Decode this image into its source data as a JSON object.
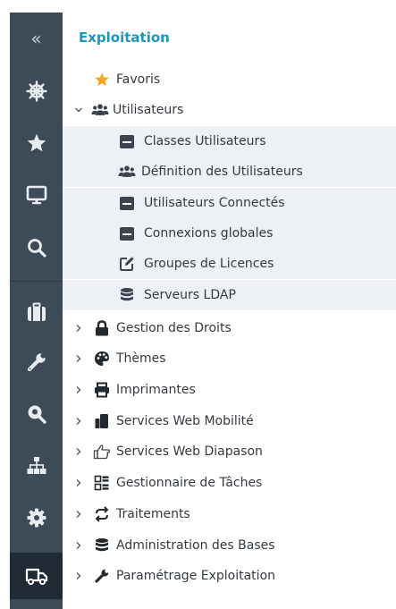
{
  "rail": {
    "collapse_glyph": "«",
    "items": [
      {
        "icon": "helm-icon"
      },
      {
        "icon": "star-icon"
      },
      {
        "icon": "monitor-icon"
      },
      {
        "icon": "search-icon"
      },
      {
        "icon": "suitcase-icon"
      },
      {
        "icon": "wrench-icon"
      },
      {
        "icon": "map-pin-search-icon"
      },
      {
        "icon": "sitemap-icon"
      },
      {
        "icon": "gear-icon"
      },
      {
        "icon": "truck-icon",
        "active": true
      }
    ]
  },
  "panel": {
    "title": "Exploitation",
    "favoris": "Favoris",
    "utilisateurs": {
      "label": "Utilisateurs",
      "children": [
        {
          "label": "Classes Utilisateurs",
          "icon": "window-icon"
        },
        {
          "label": "Définition des Utilisateurs",
          "icon": "users-icon"
        },
        {
          "label": "Utilisateurs Connectés",
          "icon": "window-icon"
        },
        {
          "label": "Connexions globales",
          "icon": "window-icon"
        },
        {
          "label": "Groupes de Licences",
          "icon": "edit-icon"
        },
        {
          "label": "Serveurs LDAP",
          "icon": "database-icon"
        }
      ]
    },
    "groups": [
      {
        "label": "Gestion des Droits",
        "icon": "lock-icon"
      },
      {
        "label": "Thèmes",
        "icon": "palette-icon"
      },
      {
        "label": "Imprimantes",
        "icon": "printer-icon"
      },
      {
        "label": "Services Web Mobilité",
        "icon": "mobile-icon"
      },
      {
        "label": "Services Web Diapason",
        "icon": "hand-point-icon"
      },
      {
        "label": "Gestionnaire de Tâches",
        "icon": "tasks-icon"
      },
      {
        "label": "Traitements",
        "icon": "refresh-icon"
      },
      {
        "label": "Administration des Bases",
        "icon": "database-icon"
      },
      {
        "label": "Paramétrage Exploitation",
        "icon": "wrench-icon"
      }
    ]
  },
  "colors": {
    "rail_bg": "#3d4a57",
    "rail_active": "#1f2a35",
    "title": "#2196b8",
    "star": "#f5a623",
    "sub_bg": "#edf1f5"
  }
}
